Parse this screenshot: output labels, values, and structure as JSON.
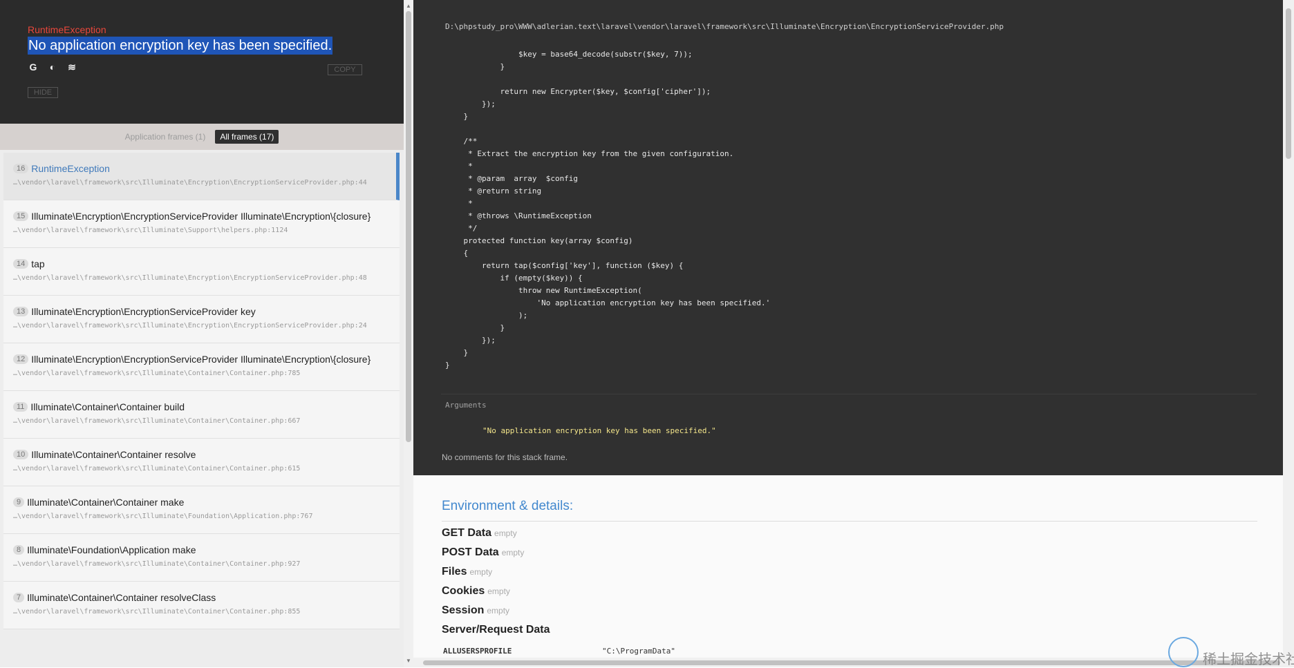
{
  "header": {
    "exception_type": "RuntimeException",
    "exception_message": "No application encryption key has been specified.",
    "icons": [
      "google-icon",
      "duckduckgo-icon",
      "stackoverflow-icon"
    ],
    "copy_label": "COPY",
    "hide_label": "HIDE"
  },
  "tabs": {
    "application_frames": "Application frames (1)",
    "all_frames": "All frames (17)"
  },
  "frames": [
    {
      "num": "16",
      "class": "RuntimeException",
      "file": "…\\vendor\\laravel\\framework\\src\\Illuminate\\Encryption\\EncryptionServiceProvider.php:44",
      "active": true
    },
    {
      "num": "15",
      "class": "Illuminate\\Encryption\\EncryptionServiceProvider Illuminate\\Encryption\\{closure}",
      "file": "…\\vendor\\laravel\\framework\\src\\Illuminate\\Support\\helpers.php:1124"
    },
    {
      "num": "14",
      "class": "tap",
      "file": "…\\vendor\\laravel\\framework\\src\\Illuminate\\Encryption\\EncryptionServiceProvider.php:48"
    },
    {
      "num": "13",
      "class": "Illuminate\\Encryption\\EncryptionServiceProvider key",
      "file": "…\\vendor\\laravel\\framework\\src\\Illuminate\\Encryption\\EncryptionServiceProvider.php:24"
    },
    {
      "num": "12",
      "class": "Illuminate\\Encryption\\EncryptionServiceProvider Illuminate\\Encryption\\{closure}",
      "file": "…\\vendor\\laravel\\framework\\src\\Illuminate\\Container\\Container.php:785"
    },
    {
      "num": "11",
      "class": "Illuminate\\Container\\Container build",
      "file": "…\\vendor\\laravel\\framework\\src\\Illuminate\\Container\\Container.php:667"
    },
    {
      "num": "10",
      "class": "Illuminate\\Container\\Container resolve",
      "file": "…\\vendor\\laravel\\framework\\src\\Illuminate\\Container\\Container.php:615"
    },
    {
      "num": "9",
      "class": "Illuminate\\Container\\Container make",
      "file": "…\\vendor\\laravel\\framework\\src\\Illuminate\\Foundation\\Application.php:767"
    },
    {
      "num": "8",
      "class": "Illuminate\\Foundation\\Application make",
      "file": "…\\vendor\\laravel\\framework\\src\\Illuminate\\Container\\Container.php:927"
    },
    {
      "num": "7",
      "class": "Illuminate\\Container\\Container resolveClass",
      "file": "…\\vendor\\laravel\\framework\\src\\Illuminate\\Container\\Container.php:855"
    }
  ],
  "code_view": {
    "file_path": "D:\\phpstudy_pro\\WWW\\adlerian.text\\laravel\\vendor\\laravel\\framework\\src\\Illuminate\\Encryption\\EncryptionServiceProvider.php",
    "code": "                $key = base64_decode(substr($key, 7));\n            }\n\n            return new Encrypter($key, $config['cipher']);\n        });\n    }\n\n    /**\n     * Extract the encryption key from the given configuration.\n     *\n     * @param  array  $config\n     * @return string\n     *\n     * @throws \\RuntimeException\n     */\n    protected function key(array $config)\n    {\n        return tap($config['key'], function ($key) {\n            if (empty($key)) {\n                throw new RuntimeException(\n                    'No application encryption key has been specified.'\n                );\n            }\n        });\n    }\n}",
    "arguments_label": "Arguments",
    "argument_value": "\"No application encryption key has been specified.\"",
    "comments": "No comments for this stack frame."
  },
  "environment": {
    "title": "Environment & details:",
    "sections": [
      {
        "name": "GET Data",
        "status": "empty"
      },
      {
        "name": "POST Data",
        "status": "empty"
      },
      {
        "name": "Files",
        "status": "empty"
      },
      {
        "name": "Cookies",
        "status": "empty"
      },
      {
        "name": "Session",
        "status": "empty"
      },
      {
        "name": "Server/Request Data",
        "status": ""
      }
    ],
    "server_rows": [
      {
        "key": "ALLUSERSPROFILE",
        "value": "\"C:\\ProgramData\""
      }
    ]
  },
  "watermark": {
    "text": "稀土掘金技术社区"
  }
}
